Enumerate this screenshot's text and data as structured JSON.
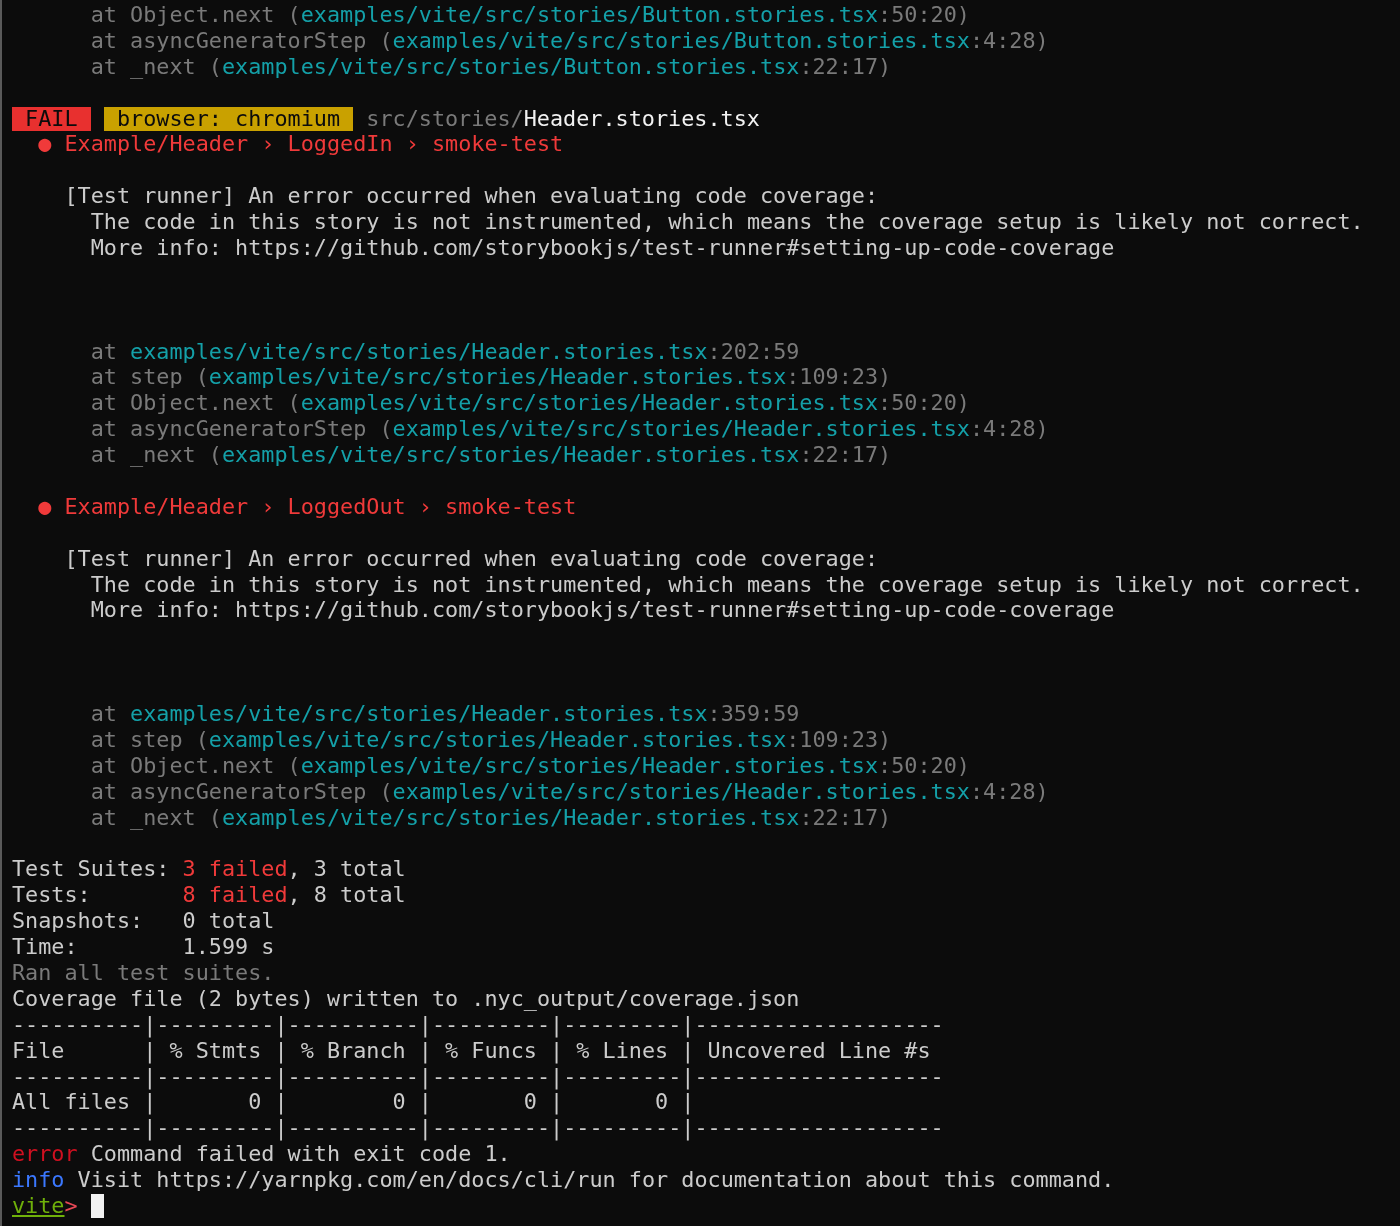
{
  "terminal": {
    "lines": [
      {
        "kind": "text",
        "segments": [
          {
            "kind": "dim",
            "text": "      at Object.next ("
          },
          {
            "kind": "link",
            "text": "examples/vite/src/stories/Button.stories.tsx"
          },
          {
            "kind": "dim",
            "text": ":50:20)"
          }
        ]
      },
      {
        "kind": "text",
        "segments": [
          {
            "kind": "dim",
            "text": "      at asyncGeneratorStep ("
          },
          {
            "kind": "link",
            "text": "examples/vite/src/stories/Button.stories.tsx"
          },
          {
            "kind": "dim",
            "text": ":4:28)"
          }
        ]
      },
      {
        "kind": "text",
        "segments": [
          {
            "kind": "dim",
            "text": "      at _next ("
          },
          {
            "kind": "link",
            "text": "examples/vite/src/stories/Button.stories.tsx"
          },
          {
            "kind": "dim",
            "text": ":22:17)"
          }
        ]
      },
      {
        "kind": "blank"
      },
      {
        "kind": "text",
        "segments": [
          {
            "kind": "fail",
            "text": "FAIL"
          },
          {
            "kind": "env",
            "text": "browser: chromium"
          },
          {
            "kind": "dim",
            "text": " src/stories/"
          },
          {
            "kind": "bright",
            "text": "Header.stories.tsx"
          }
        ]
      },
      {
        "kind": "text",
        "segments": [
          {
            "kind": "error",
            "text": "  ● Example/Header › LoggedIn › smoke-test"
          }
        ]
      },
      {
        "kind": "blank"
      },
      {
        "kind": "text",
        "segments": [
          {
            "kind": "plain",
            "text": "    [Test runner] An error occurred when evaluating code coverage:"
          }
        ]
      },
      {
        "kind": "text",
        "segments": [
          {
            "kind": "plain",
            "text": "      The code in this story is not instrumented, which means the coverage setup is likely not correct."
          }
        ]
      },
      {
        "kind": "text",
        "segments": [
          {
            "kind": "plain",
            "text": "      More info: https://github.com/storybookjs/test-runner#setting-up-code-coverage"
          }
        ]
      },
      {
        "kind": "blank"
      },
      {
        "kind": "blank"
      },
      {
        "kind": "blank"
      },
      {
        "kind": "text",
        "segments": [
          {
            "kind": "dim",
            "text": "      at "
          },
          {
            "kind": "link",
            "text": "examples/vite/src/stories/Header.stories.tsx"
          },
          {
            "kind": "dim",
            "text": ":202:59"
          }
        ]
      },
      {
        "kind": "text",
        "segments": [
          {
            "kind": "dim",
            "text": "      at step ("
          },
          {
            "kind": "link",
            "text": "examples/vite/src/stories/Header.stories.tsx"
          },
          {
            "kind": "dim",
            "text": ":109:23)"
          }
        ]
      },
      {
        "kind": "text",
        "segments": [
          {
            "kind": "dim",
            "text": "      at Object.next ("
          },
          {
            "kind": "link",
            "text": "examples/vite/src/stories/Header.stories.tsx"
          },
          {
            "kind": "dim",
            "text": ":50:20)"
          }
        ]
      },
      {
        "kind": "text",
        "segments": [
          {
            "kind": "dim",
            "text": "      at asyncGeneratorStep ("
          },
          {
            "kind": "link",
            "text": "examples/vite/src/stories/Header.stories.tsx"
          },
          {
            "kind": "dim",
            "text": ":4:28)"
          }
        ]
      },
      {
        "kind": "text",
        "segments": [
          {
            "kind": "dim",
            "text": "      at _next ("
          },
          {
            "kind": "link",
            "text": "examples/vite/src/stories/Header.stories.tsx"
          },
          {
            "kind": "dim",
            "text": ":22:17)"
          }
        ]
      },
      {
        "kind": "blank"
      },
      {
        "kind": "text",
        "segments": [
          {
            "kind": "error",
            "text": "  ● Example/Header › LoggedOut › smoke-test"
          }
        ]
      },
      {
        "kind": "blank"
      },
      {
        "kind": "text",
        "segments": [
          {
            "kind": "plain",
            "text": "    [Test runner] An error occurred when evaluating code coverage:"
          }
        ]
      },
      {
        "kind": "text",
        "segments": [
          {
            "kind": "plain",
            "text": "      The code in this story is not instrumented, which means the coverage setup is likely not correct."
          }
        ]
      },
      {
        "kind": "text",
        "segments": [
          {
            "kind": "plain",
            "text": "      More info: https://github.com/storybookjs/test-runner#setting-up-code-coverage"
          }
        ]
      },
      {
        "kind": "blank"
      },
      {
        "kind": "blank"
      },
      {
        "kind": "blank"
      },
      {
        "kind": "text",
        "segments": [
          {
            "kind": "dim",
            "text": "      at "
          },
          {
            "kind": "link",
            "text": "examples/vite/src/stories/Header.stories.tsx"
          },
          {
            "kind": "dim",
            "text": ":359:59"
          }
        ]
      },
      {
        "kind": "text",
        "segments": [
          {
            "kind": "dim",
            "text": "      at step ("
          },
          {
            "kind": "link",
            "text": "examples/vite/src/stories/Header.stories.tsx"
          },
          {
            "kind": "dim",
            "text": ":109:23)"
          }
        ]
      },
      {
        "kind": "text",
        "segments": [
          {
            "kind": "dim",
            "text": "      at Object.next ("
          },
          {
            "kind": "link",
            "text": "examples/vite/src/stories/Header.stories.tsx"
          },
          {
            "kind": "dim",
            "text": ":50:20)"
          }
        ]
      },
      {
        "kind": "text",
        "segments": [
          {
            "kind": "dim",
            "text": "      at asyncGeneratorStep ("
          },
          {
            "kind": "link",
            "text": "examples/vite/src/stories/Header.stories.tsx"
          },
          {
            "kind": "dim",
            "text": ":4:28)"
          }
        ]
      },
      {
        "kind": "text",
        "segments": [
          {
            "kind": "dim",
            "text": "      at _next ("
          },
          {
            "kind": "link",
            "text": "examples/vite/src/stories/Header.stories.tsx"
          },
          {
            "kind": "dim",
            "text": ":22:17)"
          }
        ]
      },
      {
        "kind": "blank"
      },
      {
        "kind": "text",
        "segments": [
          {
            "kind": "plain",
            "text": "Test Suites: "
          },
          {
            "kind": "error",
            "text": "3 failed"
          },
          {
            "kind": "plain",
            "text": ", 3 total"
          }
        ]
      },
      {
        "kind": "text",
        "segments": [
          {
            "kind": "plain",
            "text": "Tests:       "
          },
          {
            "kind": "error",
            "text": "8 failed"
          },
          {
            "kind": "plain",
            "text": ", 8 total"
          }
        ]
      },
      {
        "kind": "text",
        "segments": [
          {
            "kind": "plain",
            "text": "Snapshots:   0 total"
          }
        ]
      },
      {
        "kind": "text",
        "segments": [
          {
            "kind": "plain",
            "text": "Time:        1.599 s"
          }
        ]
      },
      {
        "kind": "text",
        "segments": [
          {
            "kind": "dim",
            "text": "Ran all test suites."
          }
        ]
      },
      {
        "kind": "text",
        "segments": [
          {
            "kind": "plain",
            "text": "Coverage file (2 bytes) written to .nyc_output/coverage.json"
          }
        ]
      },
      {
        "kind": "text",
        "segments": [
          {
            "kind": "plain",
            "text": "----------|---------|----------|---------|---------|-------------------"
          }
        ]
      },
      {
        "kind": "text",
        "segments": [
          {
            "kind": "plain",
            "text": "File      | % Stmts | % Branch | % Funcs | % Lines | Uncovered Line #s"
          }
        ]
      },
      {
        "kind": "text",
        "segments": [
          {
            "kind": "plain",
            "text": "----------|---------|----------|---------|---------|-------------------"
          }
        ]
      },
      {
        "kind": "text",
        "segments": [
          {
            "kind": "plain",
            "text": "All files |       0 |        0 |       0 |       0 |"
          }
        ]
      },
      {
        "kind": "text",
        "segments": [
          {
            "kind": "plain",
            "text": "----------|---------|----------|---------|---------|-------------------"
          }
        ]
      },
      {
        "kind": "text",
        "segments": [
          {
            "kind": "error-label",
            "text": "error"
          },
          {
            "kind": "plain",
            "text": " Command failed with exit code 1."
          }
        ]
      },
      {
        "kind": "text",
        "segments": [
          {
            "kind": "info-label",
            "text": "info"
          },
          {
            "kind": "plain",
            "text": " Visit https://yarnpkg.com/en/docs/cli/run for documentation about this command."
          }
        ]
      }
    ],
    "prompt": {
      "name": "vite",
      "mark": ">",
      "cursor": true
    }
  }
}
